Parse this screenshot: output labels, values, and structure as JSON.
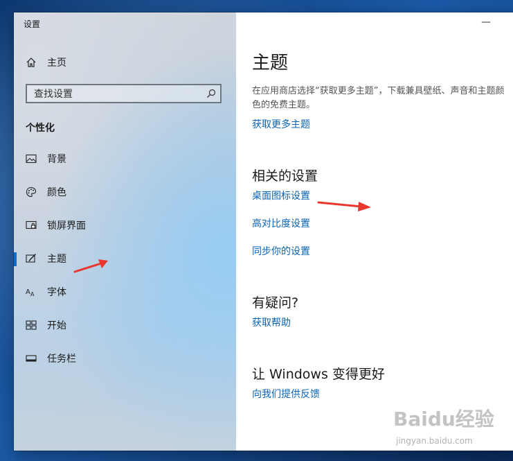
{
  "window": {
    "title": "设置",
    "minimize_glyph": "—"
  },
  "sidebar": {
    "home_label": "主页",
    "home_icon": "home-icon",
    "search": {
      "placeholder": "查找设置",
      "icon": "search-icon"
    },
    "section_title": "个性化",
    "items": [
      {
        "label": "背景",
        "icon": "picture-icon"
      },
      {
        "label": "颜色",
        "icon": "palette-icon"
      },
      {
        "label": "锁屏界面",
        "icon": "lock-screen-icon"
      },
      {
        "label": "主题",
        "icon": "theme-brush-icon",
        "active": true
      },
      {
        "label": "字体",
        "icon": "font-icon"
      },
      {
        "label": "开始",
        "icon": "start-tiles-icon"
      },
      {
        "label": "任务栏",
        "icon": "taskbar-icon"
      }
    ],
    "accent_color": "#0b6cc9"
  },
  "main": {
    "title": "主题",
    "description": "在应用商店选择“获取更多主题”，下载兼具壁纸、声音和主题颜色的免费主题。",
    "get_more_link": "获取更多主题",
    "related": {
      "heading": "相关的设置",
      "links": [
        "桌面图标设置",
        "高对比度设置",
        "同步你的设置"
      ]
    },
    "help": {
      "heading": "有疑问?",
      "link": "获取帮助"
    },
    "feedback": {
      "heading": "让 Windows 变得更好",
      "link": "向我们提供反馈"
    },
    "link_color": "#0a64b5"
  },
  "annotations": {
    "arrow_color": "#e8372e"
  },
  "watermark": {
    "line1": "Baidu经验",
    "line2": "jingyan.baidu.com"
  }
}
